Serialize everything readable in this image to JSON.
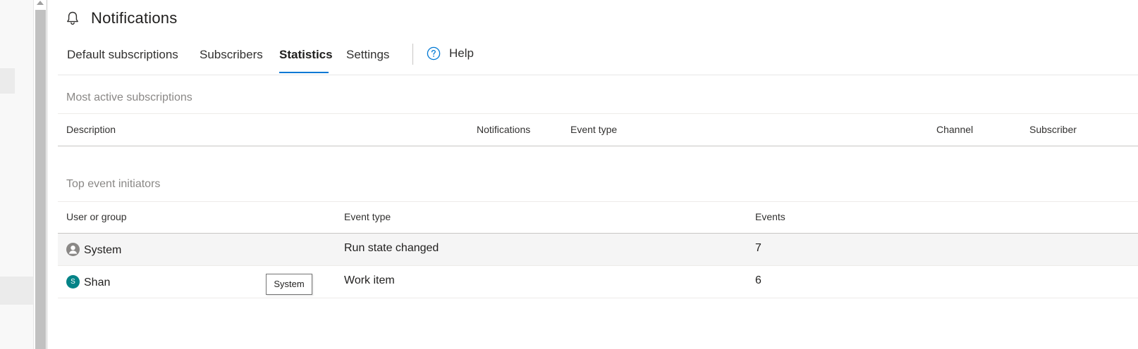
{
  "header": {
    "icon": "bell-icon",
    "title": "Notifications"
  },
  "tabs": [
    {
      "label": "Default subscriptions",
      "active": false
    },
    {
      "label": "Subscribers",
      "active": false
    },
    {
      "label": "Statistics",
      "active": true
    },
    {
      "label": "Settings",
      "active": false
    }
  ],
  "help": {
    "icon": "question-circle-icon",
    "label": "Help"
  },
  "most_active": {
    "title": "Most active subscriptions",
    "columns": [
      "Description",
      "Notifications",
      "Event type",
      "Channel",
      "Subscriber"
    ],
    "rows": []
  },
  "top_initiators": {
    "title": "Top event initiators",
    "columns": [
      "User or group",
      "Event type",
      "Events"
    ],
    "rows": [
      {
        "user": "System",
        "avatar": "person-icon",
        "event_type": "Run state changed",
        "events": "7"
      },
      {
        "user": "Shan",
        "avatar_initial": "S",
        "event_type": "Work item",
        "events": "6"
      }
    ]
  },
  "tooltip": {
    "text": "System"
  },
  "colors": {
    "accent": "#0078d4",
    "avatar_shan": "#038387",
    "avatar_system": "#8a8886",
    "row_hover": "#f5f5f5"
  }
}
